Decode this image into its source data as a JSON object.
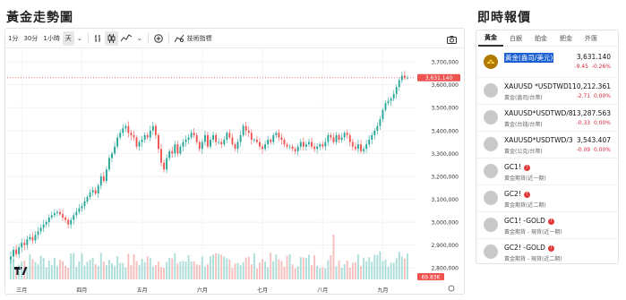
{
  "page_title": "黃金走勢圖",
  "side_title": "即時報價",
  "toolbar": {
    "intervals": [
      "1分",
      "30分",
      "1小時",
      "天"
    ],
    "active_interval": "天",
    "indicators_label": "技術指標"
  },
  "chart": {
    "y_axis_labels": [
      "3,700,000",
      "3,600,000",
      "3,500,000",
      "3,400,000",
      "3,300,000",
      "3,200,000",
      "3,100,000",
      "3,000,000",
      "2,900,000",
      "2,800,000"
    ],
    "x_axis_labels": [
      "三月",
      "四月",
      "五月",
      "六月",
      "七月",
      "八月",
      "九月"
    ],
    "current_price_tag": "3,631.140",
    "volume_tag": "69.83K",
    "up_color": "#26a69a",
    "down_color": "#ef5350",
    "price_line_color": "#ef5350"
  },
  "chart_data": {
    "type": "candlestick",
    "y_min": 2750,
    "y_max": 3720,
    "close": [
      2850,
      2880,
      2860,
      2890,
      2910,
      2900,
      2925,
      2935,
      2920,
      2945,
      2960,
      2975,
      2990,
      3000,
      3020,
      3030,
      3040,
      3045,
      3035,
      3020,
      3010,
      2990,
      3010,
      3030,
      3045,
      3060,
      3070,
      3090,
      3110,
      3130,
      3140,
      3125,
      3160,
      3200,
      3180,
      3230,
      3280,
      3300,
      3330,
      3370,
      3390,
      3410,
      3420,
      3390,
      3380,
      3370,
      3330,
      3350,
      3360,
      3380,
      3370,
      3400,
      3420,
      3380,
      3320,
      3260,
      3230,
      3280,
      3310,
      3300,
      3340,
      3300,
      3330,
      3350,
      3360,
      3370,
      3390,
      3380,
      3350,
      3320,
      3350,
      3380,
      3330,
      3360,
      3380,
      3350,
      3350,
      3340,
      3360,
      3390,
      3370,
      3340,
      3320,
      3350,
      3380,
      3420,
      3400,
      3390,
      3360,
      3360,
      3350,
      3330,
      3320,
      3340,
      3360,
      3350,
      3380,
      3390,
      3370,
      3360,
      3340,
      3330,
      3330,
      3320,
      3310,
      3330,
      3350,
      3330,
      3340,
      3350,
      3330,
      3320,
      3330,
      3340,
      3330,
      3350,
      3380,
      3370,
      3350,
      3380,
      3360,
      3370,
      3390,
      3380,
      3350,
      3330,
      3320,
      3340,
      3310,
      3320,
      3340,
      3360,
      3380,
      3400,
      3420,
      3450,
      3490,
      3520,
      3530,
      3540,
      3560,
      3590,
      3620,
      3640,
      3630,
      3631
    ],
    "volume_tag": "69.83K",
    "current_price": "3,631.140"
  },
  "tabs": [
    "黃金",
    "白銀",
    "鉑金",
    "鈀金",
    "外匯"
  ],
  "active_tab": "黃金",
  "quotes": [
    {
      "name": "黃金(盎司/美元)",
      "sub": "",
      "price": "3,631.140",
      "change": "-9.45",
      "pct": "-0.26%",
      "highlight": true
    },
    {
      "name": "XAUUSD *USDTWD",
      "sub": "黃金(盎司/台幣)",
      "price": "110,212.361",
      "change": "-2.71",
      "pct": "0.00%"
    },
    {
      "name": "XAUUSD*USDTWD/8",
      "sub": "黃金(台錢/台幣)",
      "price": "13,287.563",
      "change": "-0.33",
      "pct": "0.00%"
    },
    {
      "name": "XAUUSD*USDTWD/3",
      "sub": "黃金(公克/台幣)",
      "price": "3,543.407",
      "change": "-0.09",
      "pct": "0.00%"
    },
    {
      "name": "GC1!",
      "sub": "黃金期貨(近一期)",
      "price": "",
      "change": "",
      "pct": "",
      "warn": true
    },
    {
      "name": "GC2!",
      "sub": "黃金期貨(近二期)",
      "price": "",
      "change": "",
      "pct": "",
      "warn": true
    },
    {
      "name": "GC1! -GOLD",
      "sub": "黃金期貨 - 現貨(近一期)",
      "price": "",
      "change": "",
      "pct": "",
      "warn": true
    },
    {
      "name": "GC2! -GOLD",
      "sub": "黃金期貨 - 現貨(近二期)",
      "price": "",
      "change": "",
      "pct": "",
      "warn": true
    }
  ]
}
